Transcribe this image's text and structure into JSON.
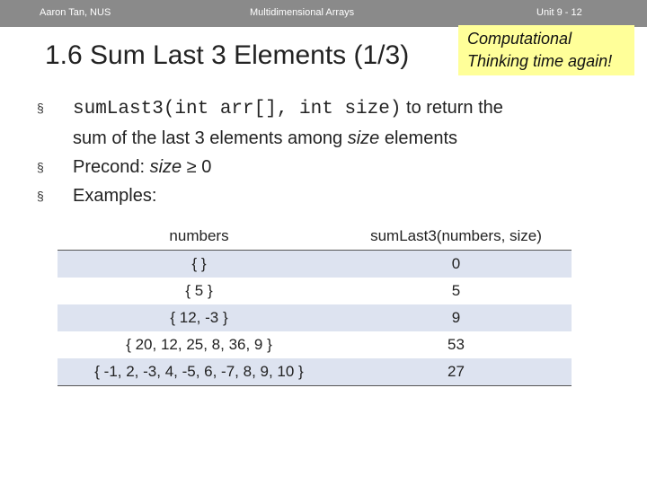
{
  "header": {
    "left": "Aaron Tan, NUS",
    "center": "Multidimensional Arrays",
    "right": "Unit 9 - 12"
  },
  "slide": {
    "title": "1.6 Sum Last 3 Elements (1/3)",
    "callout_line1": "Computational",
    "callout_line2": "Thinking time again!"
  },
  "bullets": {
    "b1_code": "sumLast3(int arr[], int size)",
    "b1_text_a": " to return the",
    "b1_text_b": "sum of the last 3 elements among ",
    "b1_text_c": "size",
    "b1_text_d": " elements",
    "b2_text_a": "Precond: ",
    "b2_text_b": "size",
    "b2_text_c": " ≥ 0",
    "b3_text": "Examples:",
    "marker": "§"
  },
  "examples": {
    "headers": [
      "numbers",
      "sumLast3(numbers, size)"
    ],
    "rows": [
      [
        "{ }",
        "0"
      ],
      [
        "{ 5 }",
        "5"
      ],
      [
        "{ 12, -3 }",
        "9"
      ],
      [
        "{ 20, 12, 25, 8, 36, 9 }",
        "53"
      ],
      [
        "{ -1, 2, -3, 4, -5, 6, -7, 8, 9, 10 }",
        "27"
      ]
    ]
  }
}
